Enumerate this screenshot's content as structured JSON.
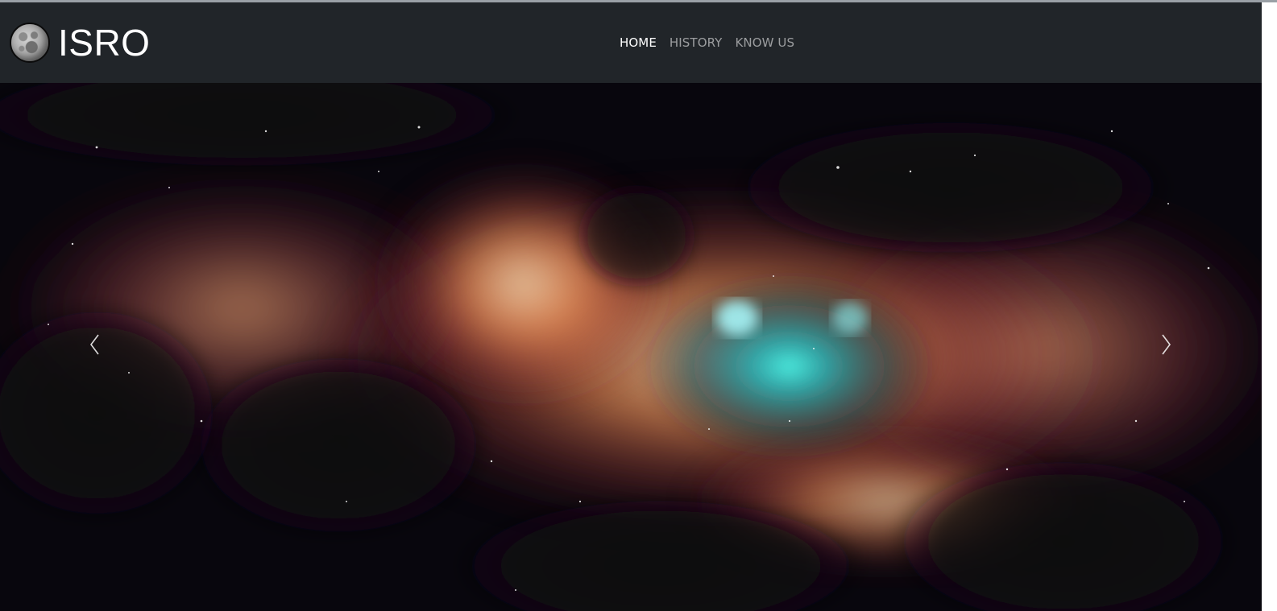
{
  "brand": {
    "name": "ISRO",
    "logo_icon": "moon-icon"
  },
  "nav": {
    "items": [
      {
        "label": "HOME",
        "active": true
      },
      {
        "label": "HISTORY",
        "active": false
      },
      {
        "label": "KNOW US",
        "active": false
      }
    ]
  },
  "carousel": {
    "slide_description_icon": "nebula-image",
    "prev_icon": "chevron-left-icon",
    "next_icon": "chevron-right-icon"
  },
  "colors": {
    "navbar_bg": "#212529",
    "nav_active": "#ffffff",
    "nav_inactive": "rgba(255,255,255,0.55)"
  }
}
